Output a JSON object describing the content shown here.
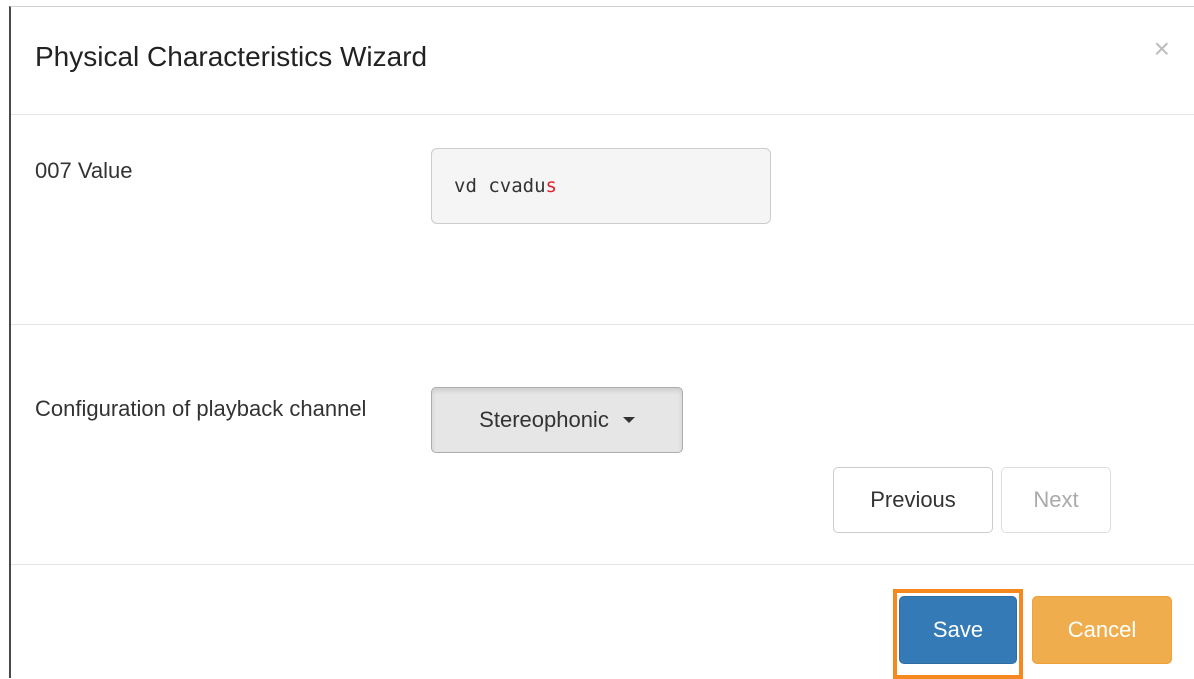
{
  "modal": {
    "title": "Physical Characteristics Wizard",
    "close_label": "×"
  },
  "field_007": {
    "label": "007 Value",
    "value_prefix": "vd cvadu",
    "value_highlight": "s"
  },
  "config_field": {
    "label": "Configuration of playback channel",
    "selected": "Stereophonic"
  },
  "nav": {
    "previous_label": "Previous",
    "next_label": "Next"
  },
  "footer": {
    "save_label": "Save",
    "cancel_label": "Cancel"
  },
  "colors": {
    "save": "#337ab7",
    "cancel": "#f0ad4e",
    "highlight_outline": "#f5891f",
    "value_highlight": "#e0202a"
  }
}
